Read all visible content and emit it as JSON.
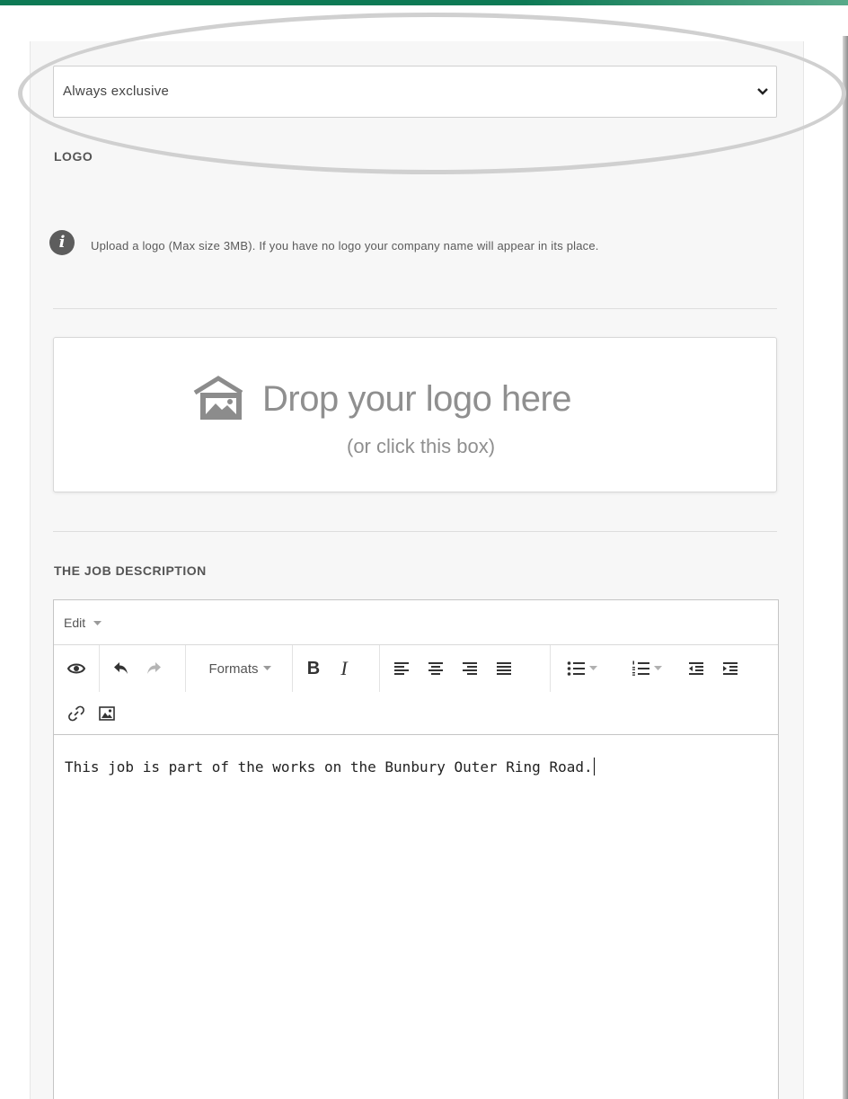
{
  "job_type_select": {
    "value": "Always exclusive"
  },
  "logo": {
    "label": "LOGO",
    "info_text": "Upload a logo (Max size 3MB). If you have no logo your company name will appear in its place.",
    "info_icon_glyph": "i",
    "dropzone_title": "Drop your logo here",
    "dropzone_subtitle": "(or click this box)"
  },
  "job_description": {
    "label": "THE JOB DESCRIPTION",
    "menu_edit": "Edit",
    "formats_label": "Formats",
    "bold_label": "B",
    "italic_label": "I",
    "content": "This job is part of the works on the Bunbury Outer Ring Road."
  },
  "colors": {
    "top_bar": "#0e7a55",
    "panel_bg": "#f7f7f7",
    "highlight_ring": "#d0d0d0"
  }
}
